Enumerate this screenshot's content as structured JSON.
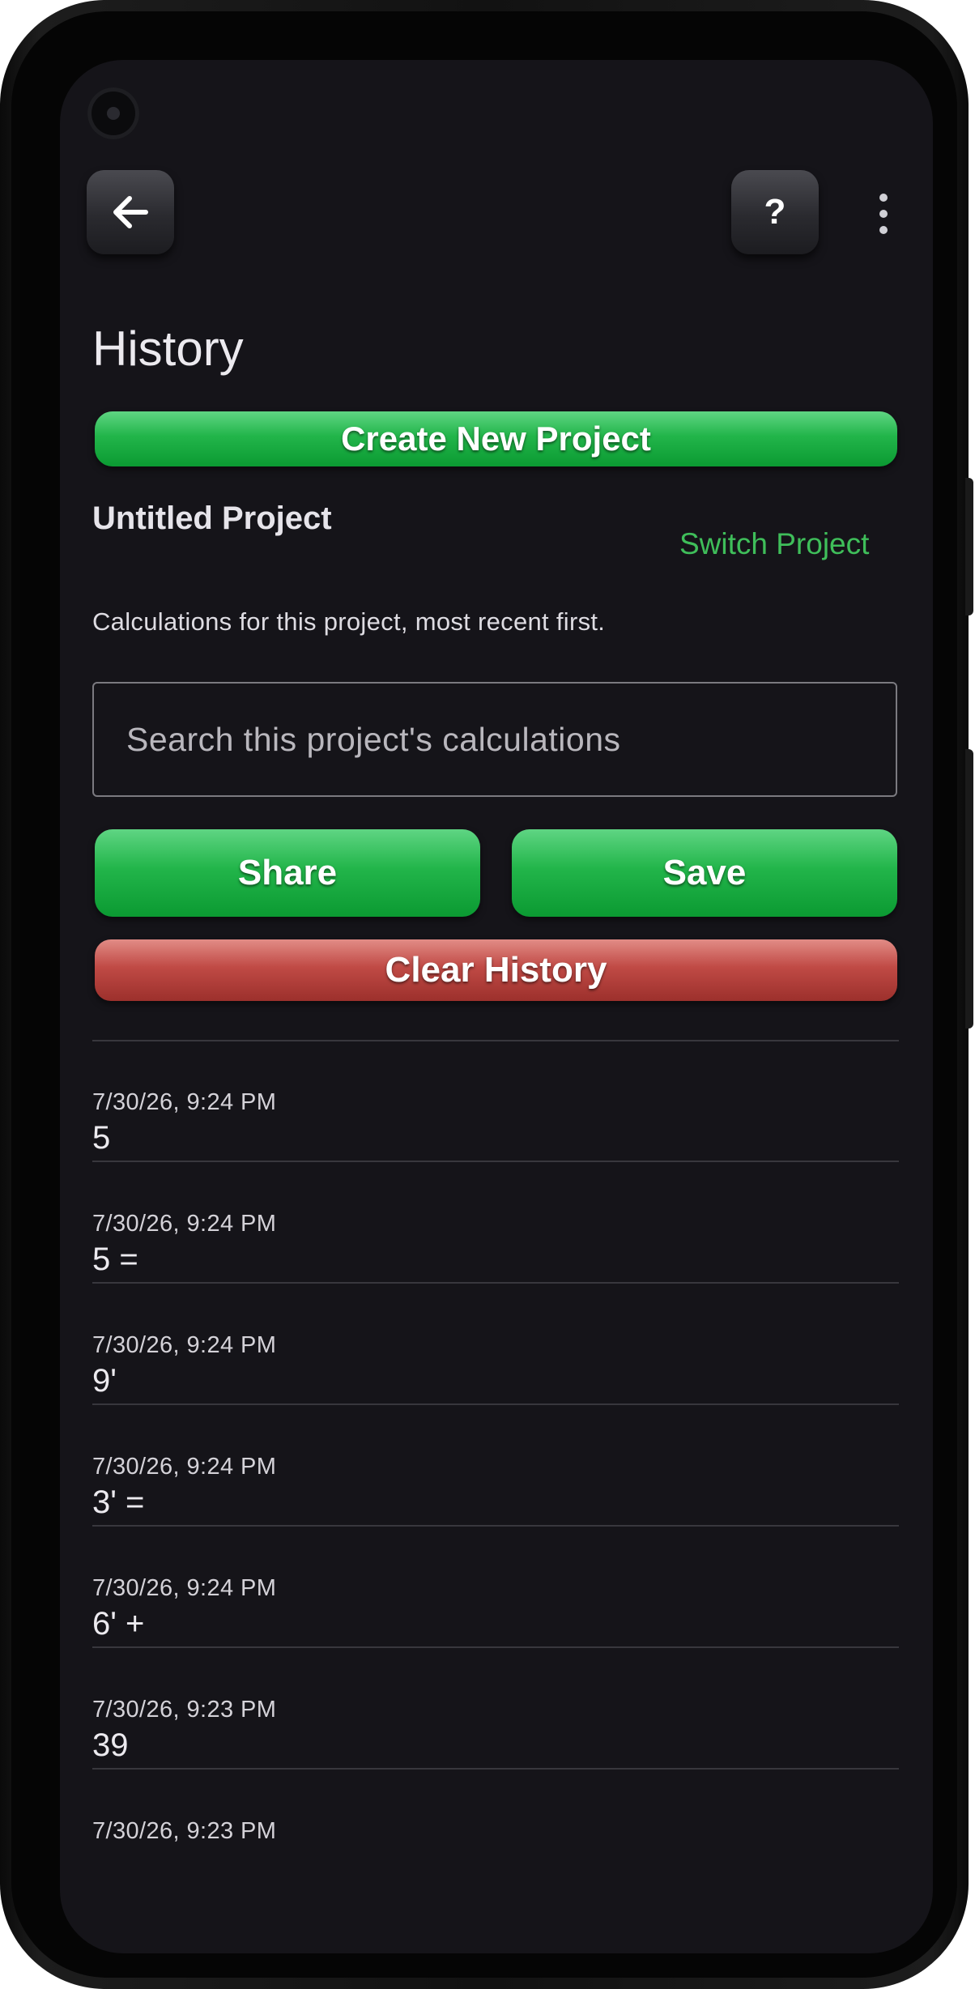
{
  "header": {
    "title": "History",
    "help_label": "?"
  },
  "actions": {
    "create_project_label": "Create New Project",
    "share_label": "Share",
    "save_label": "Save",
    "clear_label": "Clear History"
  },
  "project": {
    "name": "Untitled Project",
    "switch_label": "Switch Project",
    "description": "Calculations for this project, most recent first."
  },
  "search": {
    "placeholder": "Search this project's calculations"
  },
  "history": [
    {
      "timestamp": "7/30/26, 9:24 PM",
      "expression": "5"
    },
    {
      "timestamp": "7/30/26, 9:24 PM",
      "expression": "5 ="
    },
    {
      "timestamp": "7/30/26, 9:24 PM",
      "expression": "9'"
    },
    {
      "timestamp": "7/30/26, 9:24 PM",
      "expression": "3' ="
    },
    {
      "timestamp": "7/30/26, 9:24 PM",
      "expression": "6' +"
    },
    {
      "timestamp": "7/30/26, 9:23 PM",
      "expression": "39"
    },
    {
      "timestamp": "7/30/26, 9:23 PM",
      "expression": ""
    }
  ],
  "colors": {
    "accent_green": "#22b54a",
    "danger_red": "#c04a45",
    "background": "#151419"
  }
}
